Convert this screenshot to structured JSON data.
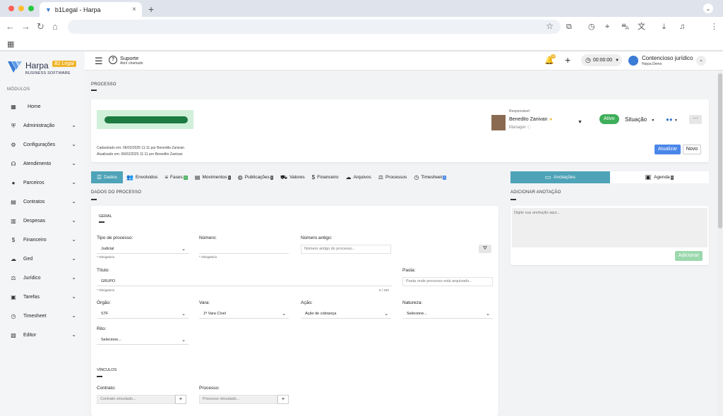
{
  "browser": {
    "tab_title": "b1Legal - Harpa",
    "tab_close": "×",
    "new_tab": "+"
  },
  "app": {
    "logo_name": "Harpa",
    "logo_badge": "B1 Legal",
    "logo_sub": "BUSINESS SOFTWARE",
    "modules_label": "MÓDULOS",
    "menu": [
      {
        "label": "Home",
        "icon": "grid-icon",
        "glyph": "▦",
        "chevron": false
      },
      {
        "label": "Administração",
        "icon": "shield-icon",
        "glyph": "⛨",
        "chevron": true
      },
      {
        "label": "Configurações",
        "icon": "gear-icon",
        "glyph": "⚙",
        "chevron": true
      },
      {
        "label": "Atendimento",
        "icon": "headset-icon",
        "glyph": "☊",
        "chevron": true
      },
      {
        "label": "Parceiros",
        "icon": "person-icon",
        "glyph": "●",
        "chevron": true
      },
      {
        "label": "Contratos",
        "icon": "document-icon",
        "glyph": "▤",
        "chevron": true
      },
      {
        "label": "Despesas",
        "icon": "receipt-icon",
        "glyph": "▥",
        "chevron": true
      },
      {
        "label": "Financeiro",
        "icon": "dollar-icon",
        "glyph": "$",
        "chevron": true
      },
      {
        "label": "Ged",
        "icon": "cloud-icon",
        "glyph": "☁",
        "chevron": true
      },
      {
        "label": "Jurídico",
        "icon": "gavel-icon",
        "glyph": "⚖",
        "chevron": true
      },
      {
        "label": "Tarefas",
        "icon": "calendar-icon",
        "glyph": "▣",
        "chevron": true
      },
      {
        "label": "Timesheet",
        "icon": "stopwatch-icon",
        "glyph": "◷",
        "chevron": true
      },
      {
        "label": "Editor",
        "icon": "file-icon",
        "glyph": "▧",
        "chevron": true
      }
    ]
  },
  "header": {
    "support_title": "Suporte",
    "support_sub": "Abrir chamado",
    "notifications_count": "29",
    "timer": "00:00:00",
    "user_name": "Contencioso jurídico",
    "user_org": "Harpa Demo"
  },
  "page": {
    "section_title": "PROCESSO",
    "created": "Cadastrado em: 06/02/2025 11:11 por Benedito Zanivan",
    "updated": "Atualizado em: 06/02/2025 11:11 por Benedito Zanivan",
    "responsible_label": "Responsável",
    "responsible_name": "Benedito Zanivan",
    "responsible_role": "Manager",
    "status": "Ativo",
    "situation": "Situação",
    "btn_update": "Atualizar",
    "btn_new": "Novo"
  },
  "tabs": [
    {
      "label": "Dados",
      "icon": "list-icon",
      "glyph": "☰",
      "active": true,
      "count": ""
    },
    {
      "label": "Envolvidos",
      "icon": "people-icon",
      "glyph": "👥",
      "active": false,
      "count": ""
    },
    {
      "label": "Fases",
      "icon": "sort-icon",
      "glyph": "≡",
      "active": false,
      "count": "11",
      "count_style": "green"
    },
    {
      "label": "Movimentos",
      "icon": "clipboard-icon",
      "glyph": "▤",
      "active": false,
      "count": "1",
      "count_style": "dark"
    },
    {
      "label": "Publicações",
      "icon": "globe-icon",
      "glyph": "◍",
      "active": false,
      "count": "0",
      "count_style": "dark"
    },
    {
      "label": "Valores",
      "icon": "cart-icon",
      "glyph": "⛟",
      "active": false,
      "count": ""
    },
    {
      "label": "Financeiro",
      "icon": "dollar-icon",
      "glyph": "$",
      "active": false,
      "count": ""
    },
    {
      "label": "Arquivos",
      "icon": "cloud-icon",
      "glyph": "☁",
      "active": false,
      "count": ""
    },
    {
      "label": "Processos",
      "icon": "gavel-icon",
      "glyph": "⚖",
      "active": false,
      "count": ""
    },
    {
      "label": "Timesheet",
      "icon": "stopwatch-icon",
      "glyph": "◷",
      "active": false,
      "count": "0",
      "count_style": "blue"
    }
  ],
  "right_tabs": [
    {
      "label": "Anotações",
      "icon": "comment-icon",
      "glyph": "▭",
      "active": true
    },
    {
      "label": "Agenda",
      "icon": "calendar-icon",
      "glyph": "▣",
      "active": false,
      "count": "0"
    }
  ],
  "form": {
    "section": "DADOS DO PROCESSO",
    "group_general": "GERAL",
    "tipo_label": "Tipo de processo:",
    "tipo_value": "Judicial",
    "numero_label": "Número:",
    "numero_antigo_label": "Número antigo:",
    "numero_antigo_placeholder": "Número antigo do processo...",
    "required": "* Obrigatório",
    "titulo_label": "Título:",
    "titulo_value": "GRUPO",
    "titulo_counter": "6 / 150",
    "pasta_label": "Pasta:",
    "pasta_placeholder": "Pasta onde processo está arquivado...",
    "orgao_label": "Órgão:",
    "orgao_value": "STF",
    "vara_label": "Vara:",
    "vara_value": "1ª Vara Cível",
    "acao_label": "Ação:",
    "acao_value": "Ação de cobrança",
    "natureza_label": "Natureza:",
    "natureza_value": "Selecione...",
    "rito_label": "Rito:",
    "rito_value": "Selecione...",
    "group_vinculos": "VÍNCULOS",
    "contrato_label": "Contrato:",
    "contrato_placeholder": "Contrato vinculado...",
    "processo_label": "Processo:",
    "processo_placeholder": "Processo vinculado..."
  },
  "notes": {
    "section": "ADICIONAR ANOTAÇÃO",
    "placeholder": "Digite sua anotação aqui...",
    "btn_add": "Adicionar"
  },
  "colors": {
    "accent": "#4fa3b8",
    "primary_blue": "#4a86e8",
    "active_green": "#3fae5a",
    "badge_yellow": "#f0b429"
  }
}
